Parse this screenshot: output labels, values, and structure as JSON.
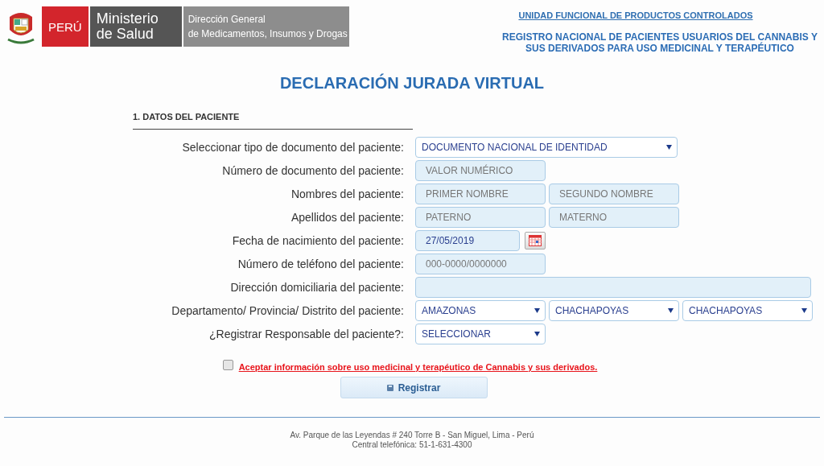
{
  "header": {
    "logo": {
      "country": "PERÚ",
      "ministry_line_1": "Ministerio",
      "ministry_line_2": "de Salud",
      "office_line_1": "Dirección General",
      "office_line_2": "de Medicamentos, Insumos y Drogas"
    },
    "unit_link": "UNIDAD FUNCIONAL DE PRODUCTOS CONTROLADOS",
    "registry_title": "REGISTRO NACIONAL DE PACIENTES USUARIOS DEL CANNABIS Y SUS DERIVADOS PARA USO MEDICINAL Y TERAPÉUTICO"
  },
  "page_title": "DECLARACIÓN JURADA VIRTUAL",
  "section_title": "1. DATOS DEL PACIENTE",
  "rows": [
    {
      "label": "Seleccionar tipo de documento del paciente:",
      "controls": [
        {
          "kind": "select",
          "value": "DOCUMENTO NACIONAL DE IDENTIDAD"
        }
      ]
    },
    {
      "label": "Número de documento del paciente:",
      "controls": [
        {
          "kind": "text",
          "placeholder": "VALOR NUMÉRICO"
        }
      ]
    },
    {
      "label": "Nombres del paciente:",
      "controls": [
        {
          "kind": "text",
          "placeholder": "PRIMER NOMBRE"
        },
        {
          "kind": "text",
          "placeholder": "SEGUNDO NOMBRE"
        }
      ]
    },
    {
      "label": "Apellidos del paciente:",
      "controls": [
        {
          "kind": "text",
          "placeholder": "PATERNO"
        },
        {
          "kind": "text",
          "placeholder": "MATERNO"
        }
      ]
    },
    {
      "label": "Fecha de nacimiento del paciente:",
      "controls": [
        {
          "kind": "date",
          "value": "27/05/2019"
        }
      ]
    },
    {
      "label": "Número de teléfono del paciente:",
      "controls": [
        {
          "kind": "text",
          "placeholder": "000-0000/0000000"
        }
      ]
    },
    {
      "label": "Dirección domiciliaria del paciente:",
      "controls": [
        {
          "kind": "text"
        }
      ]
    },
    {
      "label": "Departamento/ Provincia/ Distrito del paciente:",
      "controls": [
        {
          "kind": "select",
          "value": "AMAZONAS"
        },
        {
          "kind": "select",
          "value": "CHACHAPOYAS"
        },
        {
          "kind": "select",
          "value": "CHACHAPOYAS"
        }
      ]
    },
    {
      "label": "¿Registrar Responsable del paciente?:",
      "controls": [
        {
          "kind": "select",
          "value": "SELECCIONAR"
        }
      ]
    }
  ],
  "agreement": {
    "checked": false,
    "link": "Aceptar información sobre uso medicinal y terapéutico de Cannabis y sus derivados."
  },
  "submit_button": "Registrar",
  "footer": {
    "address": "Av. Parque de las Leyendas # 240 Torre B - San Miguel, Lima - Perú",
    "phone": "Central telefónica: 51-1-631-4300"
  }
}
